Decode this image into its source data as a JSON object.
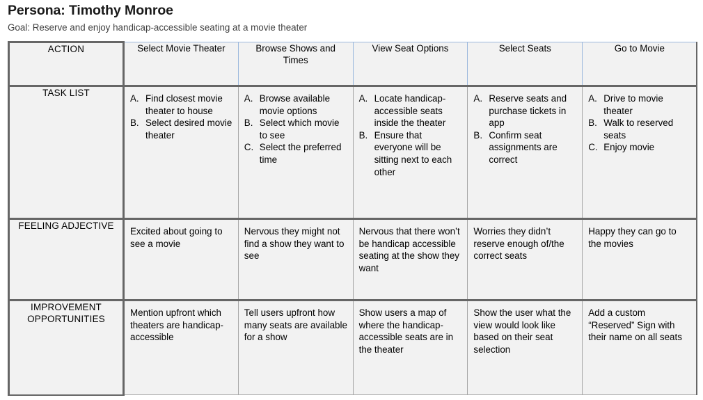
{
  "header": {
    "persona_title": "Persona: Timothy Monroe",
    "goal": "Goal: Reserve and enjoy handicap-accessible seating at a movie theater"
  },
  "matrix": {
    "corner_label": "ACTION",
    "stages": [
      "Select Movie Theater",
      "Browse Shows and Times",
      "View Seat Options",
      "Select Seats",
      "Go to Movie"
    ],
    "rows": [
      {
        "label": "TASK LIST",
        "type": "list",
        "cells": [
          {
            "items": [
              {
                "marker": "A.",
                "text": "Find closest movie theater to house"
              },
              {
                "marker": "B.",
                "text": "Select desired movie theater"
              }
            ]
          },
          {
            "items": [
              {
                "marker": "A.",
                "text": "Browse available movie options"
              },
              {
                "marker": "B.",
                "text": "Select which movie to see"
              },
              {
                "marker": "C.",
                "text": "Select the preferred time"
              }
            ]
          },
          {
            "items": [
              {
                "marker": "A.",
                "text": "Locate handicap-accessible seats inside the theater"
              },
              {
                "marker": "B.",
                "text": "Ensure that everyone will be sitting next to each other"
              }
            ]
          },
          {
            "items": [
              {
                "marker": "A.",
                "text": "Reserve seats and purchase tickets in app"
              },
              {
                "marker": "B.",
                "text": "Confirm seat assignments are correct"
              }
            ]
          },
          {
            "items": [
              {
                "marker": "A.",
                "text": "Drive to movie theater"
              },
              {
                "marker": "B.",
                "text": "Walk to reserved seats"
              },
              {
                "marker": "C.",
                "text": "Enjoy movie"
              }
            ]
          }
        ]
      },
      {
        "label": "FEELING ADJECTIVE",
        "type": "text",
        "cells": [
          {
            "text": "Excited about going to see a movie"
          },
          {
            "text": "Nervous they might not find a show they want to see"
          },
          {
            "text": "Nervous that there won’t be handicap accessible seating at the show they want"
          },
          {
            "text": "Worries they didn’t reserve enough of/the correct seats"
          },
          {
            "text": "Happy they can go to the movies"
          }
        ]
      },
      {
        "label": "IMPROVEMENT OPPORTUNITIES",
        "type": "text",
        "cells": [
          {
            "text": "Mention upfront which theaters are handicap-accessible"
          },
          {
            "text": "Tell users upfront how many seats are available for a show"
          },
          {
            "text": "Show users a map of where the handicap-accessible seats are in the theater"
          },
          {
            "text": "Show the user what the view would look like based on their seat selection"
          },
          {
            "text": "Add a custom “Reserved” Sign with their name on all seats"
          }
        ]
      }
    ]
  },
  "colors": {
    "header_accent": "#d2e1f7",
    "cell_background": "#f2f2f2",
    "thick_border": "#666666",
    "thin_border": "#a6a6a6"
  }
}
